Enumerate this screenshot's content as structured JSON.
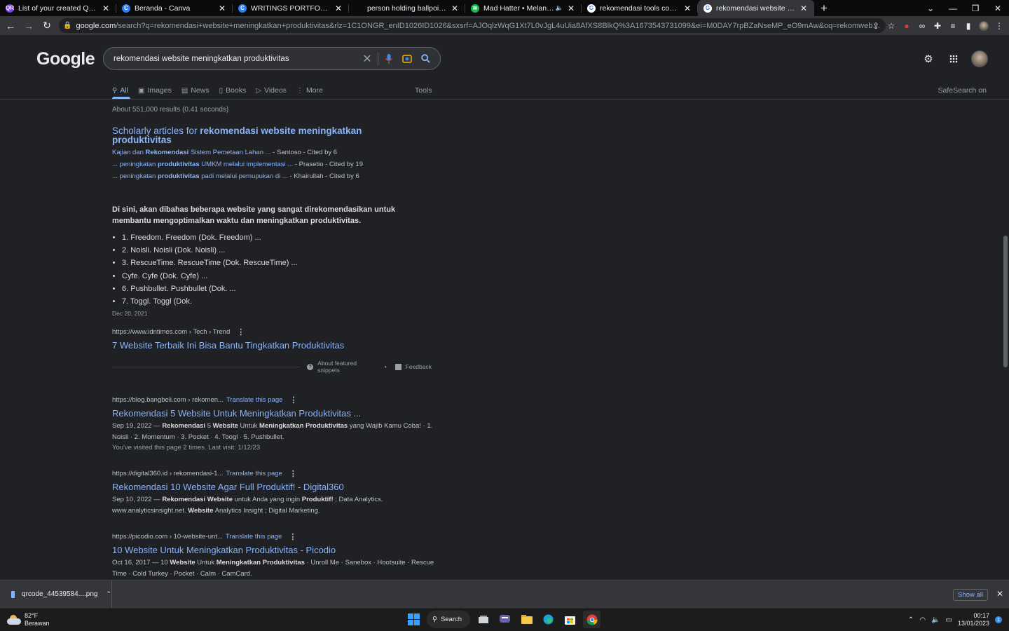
{
  "browser": {
    "tabs": [
      {
        "title": "List of your created QR codes - N",
        "icon": "qr-icon",
        "color": "#7b3fe4",
        "glyph": "QR"
      },
      {
        "title": "Beranda - Canva",
        "icon": "canva-icon",
        "color": "#2e7ff5",
        "glyph": "C"
      },
      {
        "title": "WRITINGS PORTFOLIO - A4",
        "icon": "canva-icon",
        "color": "#2e7ff5",
        "glyph": "C"
      },
      {
        "title": "person holding ballpoint pen wri",
        "icon": "unsplash-icon",
        "color": "#0b0b0c",
        "glyph": ""
      },
      {
        "title": "Mad Hatter • Melanie Martin",
        "icon": "spotify-icon",
        "color": "#1db954",
        "glyph": "≋",
        "muted": "🔈"
      },
      {
        "title": "rekomendasi tools content write",
        "icon": "google-icon",
        "color": "#ffffff",
        "glyph": "G"
      },
      {
        "title": "rekomendasi website meningkatk",
        "icon": "google-icon",
        "color": "#ffffff",
        "glyph": "G"
      }
    ],
    "url_host": "google.com",
    "url_path": "/search?q=rekomendasi+website+meningkatkan+produktivitas&rlz=1C1ONGR_enID1026ID1026&sxsrf=AJOqlzWqG1Xt7L0vJgL4uUia8AfXS8BlkQ%3A1673543731099&ei=M0DAY7rpBZaNseMP_eO9mAw&oq=rekomwebsite+meningkatkan+produkt..."
  },
  "google": {
    "logo": "Google",
    "query": "rekomendasi website meningkatkan produktivitas",
    "nav": [
      {
        "label": "All",
        "icon": "search-icon",
        "glyph": "⚲"
      },
      {
        "label": "Images",
        "icon": "image-icon",
        "glyph": "▣"
      },
      {
        "label": "News",
        "icon": "news-icon",
        "glyph": "▤"
      },
      {
        "label": "Books",
        "icon": "book-icon",
        "glyph": "▯"
      },
      {
        "label": "Videos",
        "icon": "video-icon",
        "glyph": "▷"
      },
      {
        "label": "More",
        "icon": "more-icon",
        "glyph": "⋮"
      }
    ],
    "tools": "Tools",
    "safesearch": "SafeSearch on",
    "stats": "About 551,000 results (0.41 seconds)"
  },
  "scholar": {
    "title_pre": "Scholarly articles for ",
    "title_bold": "rekomendasi website meningkatkan produktivitas",
    "items": [
      {
        "pre": "Kajian dan ",
        "bold": "Rekomendasi",
        "post": " Sistem Pemetaan Lahan ...",
        "meta": " - Santoso - Cited by 6"
      },
      {
        "pre": "... peningkatan ",
        "bold": "produktivitas",
        "post": " UMKM melalui implementasi ...",
        "meta": " - Prasetio - Cited by 19"
      },
      {
        "pre": "... peningkatan ",
        "bold": "produktivitas",
        "post": " padi melalui pemupukan di ...",
        "meta": " - Khairullah - Cited by 6"
      }
    ]
  },
  "snippet": {
    "heading": "Di sini, akan dibahas beberapa website yang sangat direkomendasikan untuk membantu mengoptimalkan waktu dan meningkatkan produktivitas.",
    "items": [
      "1. Freedom. Freedom (Dok. Freedom) ...",
      "2. Noisli. Noisli (Dok. Noisli) ...",
      "3. RescueTime. RescueTime (Dok. RescueTime) ...",
      "Cyfe. Cyfe (Dok. Cyfe) ...",
      "6. Pushbullet. Pushbullet (Dok. ...",
      "7. Toggl. Toggl (Dok."
    ],
    "date": "Dec 20, 2021",
    "cite": "https://www.idntimes.com › Tech › Trend",
    "link": "7 Website Terbaik Ini Bisa Bantu Tingkatkan Produktivitas",
    "about": "About featured snippets",
    "feedback": "Feedback"
  },
  "results": [
    {
      "cite": "https://blog.bangbeli.com › rekomen...",
      "translate": "Translate this page",
      "title": "Rekomendasi 5 Website Untuk Meningkatkan Produktivitas ...",
      "desc_parts": [
        {
          "t": "Sep 19, 2022 — ",
          "b": false
        },
        {
          "t": "Rekomendasi",
          "b": true
        },
        {
          "t": " 5 ",
          "b": false
        },
        {
          "t": "Website",
          "b": true
        },
        {
          "t": " Untuk ",
          "b": false
        },
        {
          "t": "Meningkatkan Produktivitas",
          "b": true
        },
        {
          "t": " yang Wajib Kamu Coba! · 1. Noisli · 2. Momentum · 3. Pocket · 4. Toogl · 5. Pushbullet.",
          "b": false
        }
      ],
      "visit": "You've visited this page 2 times. Last visit: 1/12/23"
    },
    {
      "cite": "https://digital360.id › rekomendasi-1...",
      "translate": "Translate this page",
      "title": "Rekomendasi 10 Website Agar Full Produktif! - Digital360",
      "desc_parts": [
        {
          "t": "Sep 10, 2022 — ",
          "b": false
        },
        {
          "t": "Rekomendasi Website",
          "b": true
        },
        {
          "t": " untuk Anda yang ingin ",
          "b": false
        },
        {
          "t": "Produktif!",
          "b": true
        },
        {
          "t": " ; Data Analytics. www.analyticsinsight.net. ",
          "b": false
        },
        {
          "t": "Website",
          "b": true
        },
        {
          "t": " Analytics Insight ; Digital Marketing.",
          "b": false
        }
      ],
      "visit": ""
    },
    {
      "cite": "https://picodio.com › 10-website-unt...",
      "translate": "Translate this page",
      "title": "10 Website Untuk Meningkatkan Produktivitas - Picodio",
      "desc_parts": [
        {
          "t": "Oct 16, 2017 — 10 ",
          "b": false
        },
        {
          "t": "Website",
          "b": true
        },
        {
          "t": " Untuk ",
          "b": false
        },
        {
          "t": "Meningkatkan Produktivitas",
          "b": true
        },
        {
          "t": " · Unroll Me · Sanebox · Hootsuite · Rescue Time · Cold Turkey · Pocket · Calm · CamCard.",
          "b": false
        }
      ],
      "visit": ""
    }
  ],
  "download": {
    "filename": "qrcode_44539584....png",
    "show_all": "Show all"
  },
  "taskbar": {
    "temp": "82°F",
    "weather": "Berawan",
    "search": "Search",
    "time": "00:17",
    "date": "13/01/2023",
    "notif_count": "1"
  }
}
